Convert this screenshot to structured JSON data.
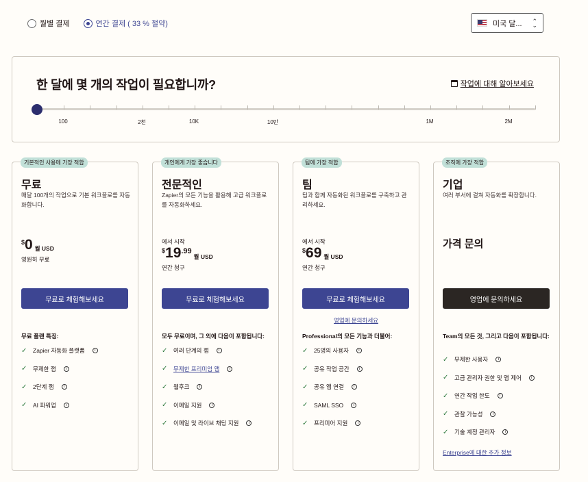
{
  "billing": {
    "monthly_label": "월별 결제",
    "annual_label": "연간 결제 ( 33 % 절약)"
  },
  "currency": {
    "label": "미국 달..."
  },
  "task_panel": {
    "title": "한 달에 몇 개의 작업이 필요합니까?",
    "learn_link": "작업에 대해 알아보세요",
    "tick_labels": [
      "100",
      "2천",
      "10K",
      "10만",
      "1M",
      "2M"
    ],
    "selected_index": 0
  },
  "plans": [
    {
      "badge": "기본적인 사용에 가장 적합",
      "name": "무료",
      "description": "매달 100개의 작업으로 기본 워크플로를 자동화합니다.",
      "price_prefix": "",
      "currency": "$",
      "amount": "0",
      "cents": "",
      "per": "월 USD",
      "price_note": "영원히 무료",
      "cta": "무료로 체험해보세요",
      "features_title": "무료 플랜 특징:",
      "features": [
        {
          "text": "Zapier 자동화 플랫폼",
          "linked": false
        },
        {
          "text": "무제한 잽",
          "linked": false
        },
        {
          "text": "2단계 잽",
          "linked": false
        },
        {
          "text": "AI 파워업",
          "linked": false
        }
      ]
    },
    {
      "badge": "개인에게 가장 좋습니다",
      "name": "전문적인",
      "description": "Zapier의 모든 기능을 활용해 고급 워크플로를 자동화하세요.",
      "price_prefix": "에서 시작",
      "currency": "$",
      "amount": "19",
      "cents": ".99",
      "per": "월 USD",
      "price_note": "연간 청구",
      "cta": "무료로 체험해보세요",
      "features_title": "모두 무료이며, 그 외에 다음이 포함됩니다:",
      "features": [
        {
          "text": "여러 단계의 잽",
          "linked": false
        },
        {
          "text": "무제한 프리미엄 앱",
          "linked": true
        },
        {
          "text": "웹후크",
          "linked": false
        },
        {
          "text": "이메일 지원",
          "linked": false
        },
        {
          "text": "이메일 및 라이브 채팅 지원",
          "linked": false
        }
      ]
    },
    {
      "badge": "팀에 가장 적합",
      "name": "팀",
      "description": "팀과 함께 자동화된 워크플로를 구축하고 관리하세요.",
      "price_prefix": "에서 시작",
      "currency": "$",
      "amount": "69",
      "cents": "",
      "per": "월 USD",
      "price_note": "연간 청구",
      "cta": "무료로 체험해보세요",
      "sub_link": "영업에 문의하세요",
      "features_title": "Professional의 모든 기능과 더불어:",
      "features": [
        {
          "text": "25명의 사용자",
          "linked": false
        },
        {
          "text": "공유 작업 공간",
          "linked": false
        },
        {
          "text": "공유 앱 연결",
          "linked": false
        },
        {
          "text": "SAML SSO",
          "linked": false
        },
        {
          "text": "프리미어 지원",
          "linked": false
        }
      ]
    },
    {
      "badge": "조직에 가장 적합",
      "name": "기업",
      "description": "여러 부서에 걸쳐 자동화를 확장합니다.",
      "contact_price": "가격 문의",
      "cta": "영업에 문의하세요",
      "features_title": "Team의 모든 것, 그리고 다음이 포함됩니다:",
      "features": [
        {
          "text": "무제한 사용자",
          "linked": false
        },
        {
          "text": "고급 관리자 권한 및 앱 제어",
          "linked": false
        },
        {
          "text": "연간 작업 한도",
          "linked": false
        },
        {
          "text": "관찰 가능성",
          "linked": false
        },
        {
          "text": "기술 계정 관리자",
          "linked": false
        }
      ],
      "more_link": "Enterprise에 대한 추가 정보"
    }
  ],
  "colors": {
    "accent": "#3d4592",
    "dark_button": "#2b2623",
    "badge": "#c1e0d8",
    "check": "#2f7a3e"
  }
}
